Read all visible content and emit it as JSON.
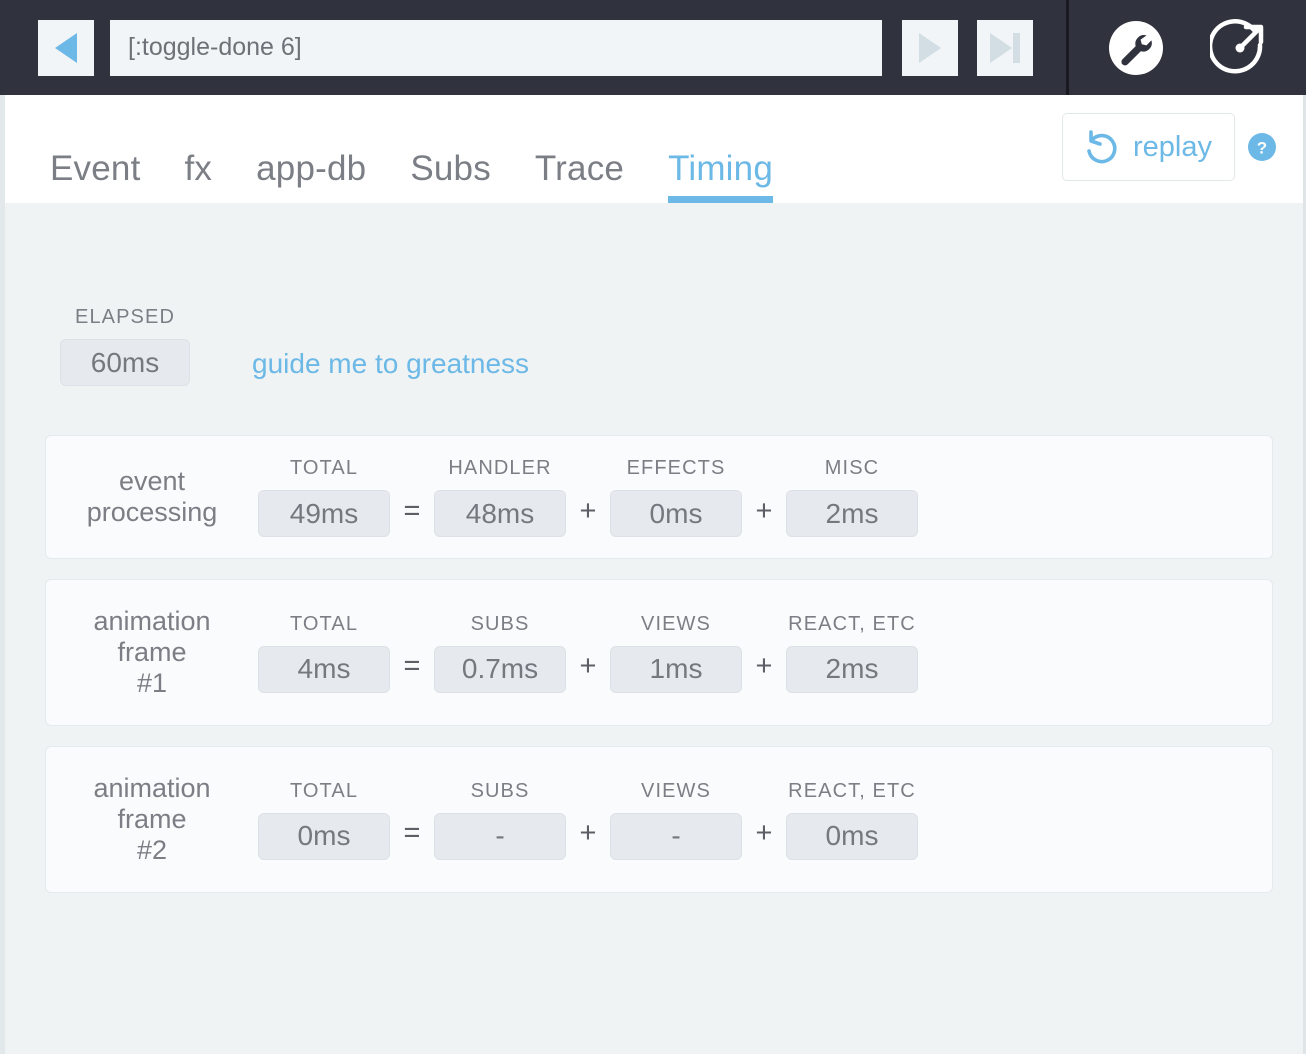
{
  "toolbar": {
    "prev_button": "previous-epoch",
    "event_value": "[:toggle-done 6]",
    "next_button": "next-epoch",
    "last_button": "last-epoch",
    "settings_icon": "wrench-circle-icon",
    "popout_icon": "external-link-icon"
  },
  "tabs": [
    {
      "label": "Event",
      "active": false
    },
    {
      "label": "fx",
      "active": false
    },
    {
      "label": "app-db",
      "active": false
    },
    {
      "label": "Subs",
      "active": false
    },
    {
      "label": "Trace",
      "active": false
    },
    {
      "label": "Timing",
      "active": true
    }
  ],
  "replay": {
    "label": "replay",
    "icon": "undo-arrow-icon",
    "help_icon": "question-circle-icon"
  },
  "elapsed": {
    "label": "ELAPSED",
    "value": "60ms",
    "link": "guide me to greatness"
  },
  "rows": [
    {
      "title": "event\nprocessing",
      "metrics": [
        {
          "label": "TOTAL",
          "value": "49ms"
        },
        {
          "label": "HANDLER",
          "value": "48ms"
        },
        {
          "label": "EFFECTS",
          "value": "0ms"
        },
        {
          "label": "MISC",
          "value": "2ms"
        }
      ],
      "ops": [
        "=",
        "+",
        "+"
      ]
    },
    {
      "title": "animation\nframe\n#1",
      "metrics": [
        {
          "label": "TOTAL",
          "value": "4ms"
        },
        {
          "label": "SUBS",
          "value": "0.7ms"
        },
        {
          "label": "VIEWS",
          "value": "1ms"
        },
        {
          "label": "REACT, ETC",
          "value": "2ms"
        }
      ],
      "ops": [
        "=",
        "+",
        "+"
      ]
    },
    {
      "title": "animation\nframe\n#2",
      "metrics": [
        {
          "label": "TOTAL",
          "value": "0ms"
        },
        {
          "label": "SUBS",
          "value": "-"
        },
        {
          "label": "VIEWS",
          "value": "-"
        },
        {
          "label": "REACT, ETC",
          "value": "0ms"
        }
      ],
      "ops": [
        "=",
        "+",
        "+"
      ]
    }
  ],
  "colors": {
    "toolbar_bg": "#30323d",
    "accent_blue": "#6cb8e6",
    "page_bg": "#eff3f4",
    "card_bg": "#fafbfc",
    "pill_bg": "#e6eaee",
    "text_grey": "#7b7f85"
  }
}
